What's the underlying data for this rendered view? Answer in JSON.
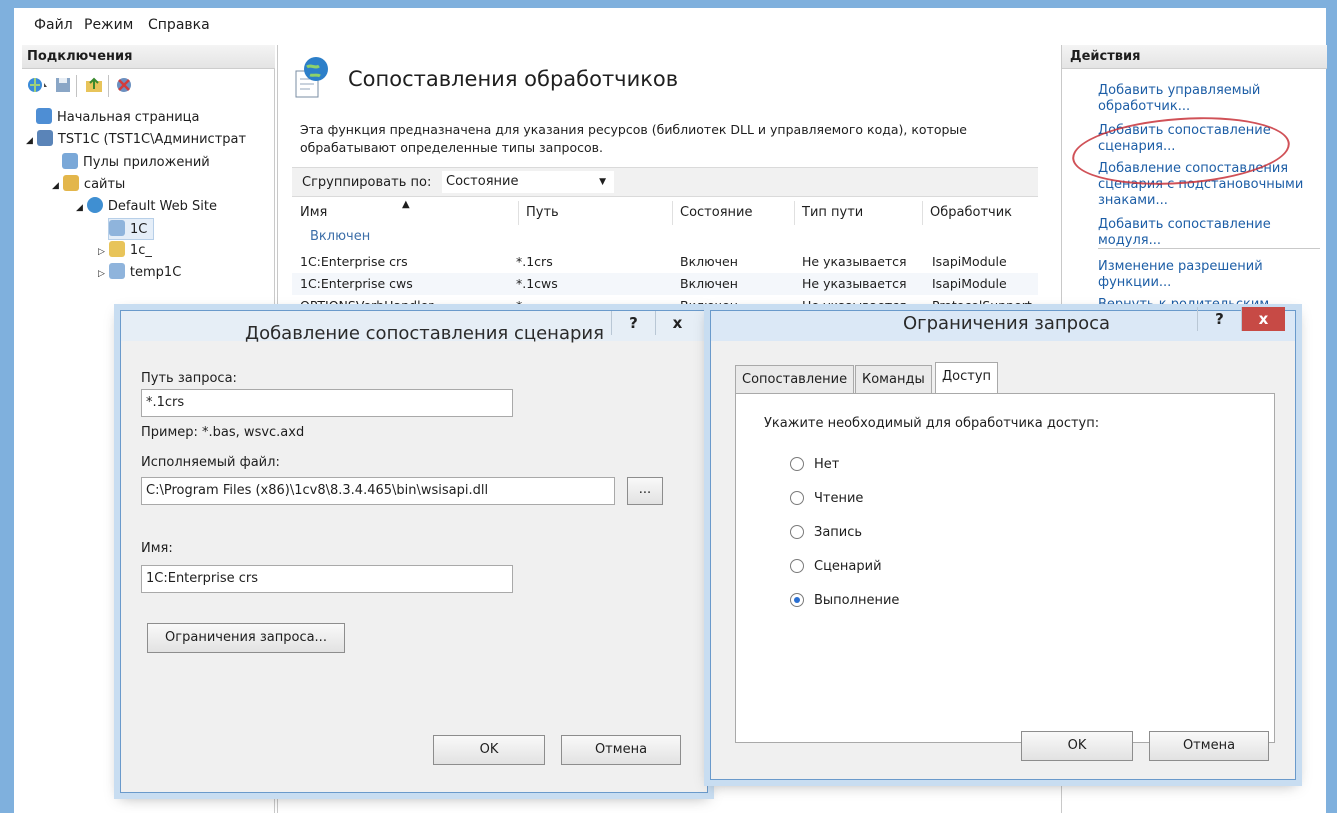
{
  "menu": {
    "file": "Файл",
    "mode": "Режим",
    "help": "Справка"
  },
  "connections": {
    "title": "Подключения",
    "tree": [
      {
        "label": "Начальная страница"
      },
      {
        "label": "TST1C (TST1C\\Администрат"
      },
      {
        "label": "Пулы приложений"
      },
      {
        "label": "сайты"
      },
      {
        "label": "Default Web Site"
      },
      {
        "label": "1C"
      },
      {
        "label": "1c_"
      },
      {
        "label": "temp1C"
      }
    ]
  },
  "center": {
    "heading": "Сопоставления обработчиков",
    "description": "Эта функция предназначена для указания ресурсов (библиотек DLL и управляемого кода), которые обрабатывают определенные типы запросов.",
    "group_by_label": "Сгруппировать по:",
    "group_by_value": "Состояние",
    "columns": [
      "Имя",
      "Путь",
      "Состояние",
      "Тип пути",
      "Обработчик"
    ],
    "group": "Включен",
    "rows": [
      {
        "name": "1C:Enterprise crs",
        "path": "*.1crs",
        "state": "Включен",
        "path_type": "Не указывается",
        "handler": "IsapiModule"
      },
      {
        "name": "1C:Enterprise cws",
        "path": "*.1cws",
        "state": "Включен",
        "path_type": "Не указывается",
        "handler": "IsapiModule"
      },
      {
        "name": "OPTIONSVerbHandler",
        "path": "*",
        "state": "Включен",
        "path_type": "Не указывается",
        "handler": "ProtocolSupport"
      }
    ]
  },
  "actions": {
    "title": "Действия",
    "links": [
      "Добавить управляемый обработчик...",
      "Добавить сопоставление сценария...",
      "Добавление сопоставления сценария с подстановочными знаками...",
      "Добавить сопоставление модуля...",
      "Изменение разрешений функции...",
      "Вернуть к родительским"
    ]
  },
  "script_dialog": {
    "title": "Добавление сопоставления сценария",
    "help_btn": "?",
    "close_btn": "x",
    "request_path_label": "Путь запроса:",
    "request_path_value": "*.1crs",
    "example": "Пример: *.bas, wsvc.axd",
    "executable_label": "Исполняемый файл:",
    "executable_value": "C:\\Program Files (x86)\\1cv8\\8.3.4.465\\bin\\wsisapi.dll",
    "browse_btn": "...",
    "name_label": "Имя:",
    "name_value": "1C:Enterprise crs",
    "restrictions_btn": "Ограничения запроса...",
    "ok": "OK",
    "cancel": "Отмена"
  },
  "restrictions_dialog": {
    "title": "Ограничения запроса",
    "help_btn": "?",
    "close_btn": "x",
    "tabs": [
      "Сопоставление",
      "Команды",
      "Доступ"
    ],
    "active_tab": "Доступ",
    "prompt": "Укажите необходимый для обработчика доступ:",
    "options": [
      "Нет",
      "Чтение",
      "Запись",
      "Сценарий",
      "Выполнение"
    ],
    "selected": "Выполнение",
    "ok": "OK",
    "cancel": "Отмена"
  },
  "colors": {
    "frame": "#7fb0dd",
    "link": "#1d5ea6",
    "annotation": "#c8323a",
    "radio_selected": "#2a6fd1"
  }
}
